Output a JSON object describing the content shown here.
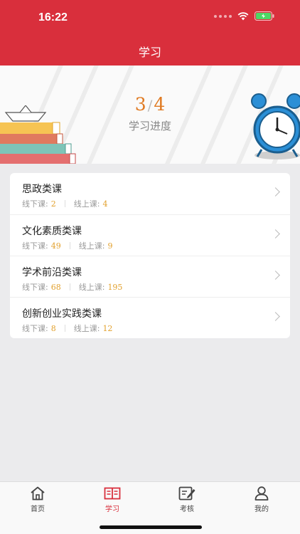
{
  "status_bar": {
    "time": "16:22"
  },
  "header": {
    "title": "学习"
  },
  "progress": {
    "completed": "3",
    "total": "4",
    "separator": "/",
    "label": "学习进度"
  },
  "courses": [
    {
      "title": "思政类课",
      "offline_label": "线下课:",
      "offline": "2",
      "online_label": "线上课:",
      "online": "4"
    },
    {
      "title": "文化素质类课",
      "offline_label": "线下课:",
      "offline": "49",
      "online_label": "线上课:",
      "online": "9"
    },
    {
      "title": "学术前沿类课",
      "offline_label": "线下课:",
      "offline": "68",
      "online_label": "线上课:",
      "online": "195"
    },
    {
      "title": "创新创业实践类课",
      "offline_label": "线下课:",
      "offline": "8",
      "online_label": "线上课:",
      "online": "12"
    }
  ],
  "tabs": [
    {
      "label": "首页",
      "icon": "home-icon",
      "active": false
    },
    {
      "label": "学习",
      "icon": "book-icon",
      "active": true
    },
    {
      "label": "考核",
      "icon": "edit-icon",
      "active": false
    },
    {
      "label": "我的",
      "icon": "user-icon",
      "active": false
    }
  ],
  "colors": {
    "brand": "#d92f3c",
    "accent": "#e07a22",
    "number": "#e2a02c"
  }
}
